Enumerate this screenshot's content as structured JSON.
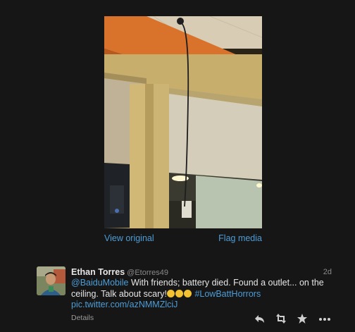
{
  "media": {
    "view_original_label": "View original",
    "flag_media_label": "Flag media"
  },
  "tweet": {
    "author": {
      "full_name": "Ethan Torres",
      "screen_name": "@Etorres49"
    },
    "timestamp": "2d",
    "text": {
      "mention": "@BaiduMobile",
      "body": " With friends; battery died. Found a outlet... on the ceiling. Talk about scary!",
      "hashtag": "#LowBattHorrors",
      "pic_link": "pic.twitter.com/azNMMZlciJ"
    },
    "details_label": "Details"
  },
  "icons": {
    "reply": "reply-icon",
    "retweet": "retweet-icon",
    "favorite": "star-icon",
    "more": "more-icon"
  },
  "colors": {
    "background": "#161616",
    "link": "#4d9dd6",
    "text": "#e6e6e6",
    "muted": "#8a8a8a",
    "icon": "#cfcfcf"
  }
}
